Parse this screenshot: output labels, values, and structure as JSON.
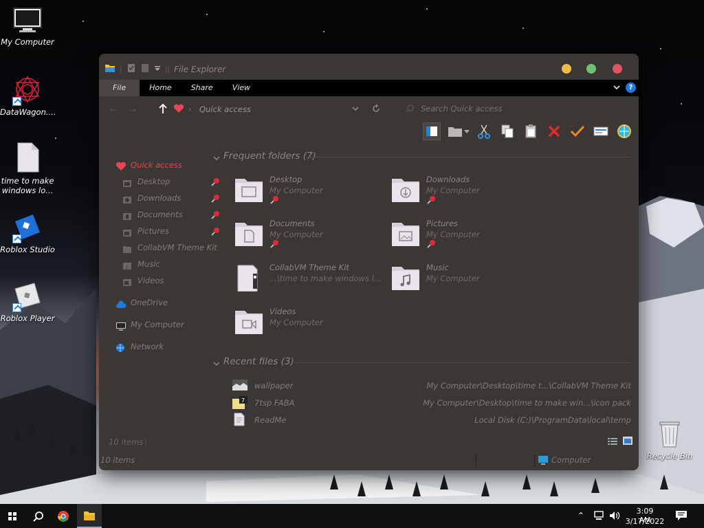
{
  "desktop": {
    "icons": [
      {
        "label": "My Computer",
        "icon": "monitor-icon"
      },
      {
        "label": "DataWagon....",
        "icon": "datawagon-icon"
      },
      {
        "label": "time to make windows lo...",
        "icon": "file-icon"
      },
      {
        "label": "Roblox Studio",
        "icon": "roblox-studio-icon"
      },
      {
        "label": "Roblox Player",
        "icon": "roblox-player-icon"
      },
      {
        "label": "Recycle Bin",
        "icon": "recycle-bin-icon"
      }
    ]
  },
  "window": {
    "title": "File Explorer",
    "ribbon_tabs": [
      "File",
      "Home",
      "Share",
      "View"
    ],
    "address": "Quick access",
    "search_placeholder": "Search Quick access",
    "nav": {
      "quick_access": "Quick access",
      "items": [
        {
          "label": "Desktop",
          "pinned": true
        },
        {
          "label": "Downloads",
          "pinned": true
        },
        {
          "label": "Documents",
          "pinned": true
        },
        {
          "label": "Pictures",
          "pinned": true
        },
        {
          "label": "CollabVM Theme Kit",
          "pinned": false
        },
        {
          "label": "Music",
          "pinned": false
        },
        {
          "label": "Videos",
          "pinned": false
        }
      ],
      "onedrive": "OneDrive",
      "computer": "My Computer",
      "network": "Network"
    },
    "frequent": {
      "heading": "Frequent folders (7)",
      "folders": [
        {
          "name": "Desktop",
          "location": "My Computer",
          "pinned": true
        },
        {
          "name": "Downloads",
          "location": "My Computer",
          "pinned": true
        },
        {
          "name": "Documents",
          "location": "My Computer",
          "pinned": true
        },
        {
          "name": "Pictures",
          "location": "My Computer",
          "pinned": true
        },
        {
          "name": "CollabVM Theme Kit",
          "location": "...\\time to make windows l...",
          "pinned": false
        },
        {
          "name": "Music",
          "location": "My Computer",
          "pinned": false
        },
        {
          "name": "Videos",
          "location": "My Computer",
          "pinned": false
        }
      ]
    },
    "recent": {
      "heading": "Recent files (3)",
      "files": [
        {
          "name": "wallpaper",
          "path": "My Computer\\Desktop\\time t...\\CollabVM Theme Kit"
        },
        {
          "name": "7tsp FABA",
          "path": "My Computer\\Desktop\\time to make win...\\icon pack"
        },
        {
          "name": "ReadMe",
          "path": "Local Disk (C:)\\ProgramData\\local\\temp"
        }
      ]
    },
    "items_count": "10 items",
    "status_items": "10 items",
    "status_location": "Computer"
  },
  "taskbar": {
    "time": "3:09 AM",
    "date": "3/17/2022"
  },
  "colors": {
    "window_bg": "#3a3735",
    "ribbon_bg": "#000000",
    "close": "#e05560",
    "maximize": "#6fbf73",
    "minimize": "#f1b94a",
    "accent_red": "#e8445a"
  }
}
